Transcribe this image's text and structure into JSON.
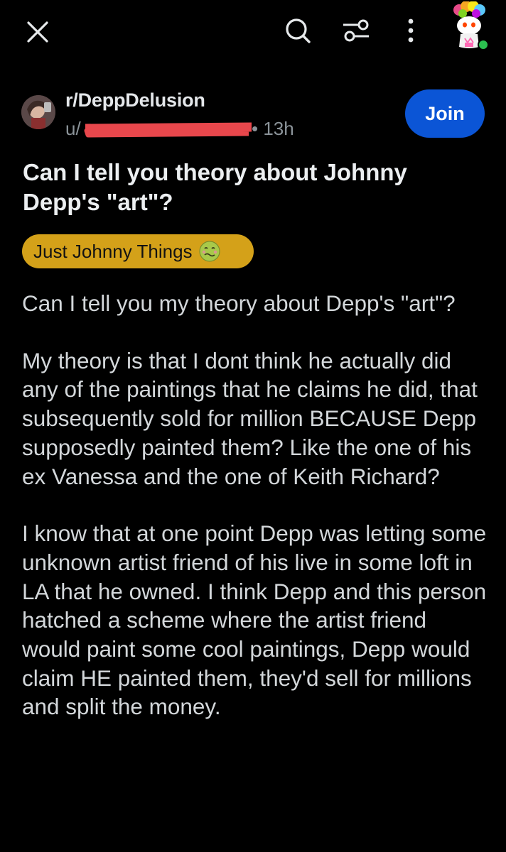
{
  "topbar": {
    "close_icon": "close-icon",
    "search_icon": "search-icon",
    "filter_icon": "sliders-icon",
    "more_icon": "more-vertical-icon",
    "online_status_color": "#2bbf4f"
  },
  "post": {
    "subreddit": "r/DeppDelusion",
    "user_prefix": "u/",
    "time": "• 13h",
    "join_label": "Join",
    "title": "Can I tell you theory about Johnny Depp's \"art\"?",
    "flair": {
      "label": "Just Johnny Things",
      "emoji": "nauseated-face",
      "color": "#d4a119"
    },
    "body": [
      "Can I tell you my theory about Depp's \"art\"?",
      "My theory is that I dont think he actually did any of the paintings that he claims he did, that subsequently sold for million BECAUSE Depp supposedly painted them? Like the one of his ex Vanessa and the one of Keith Richard?",
      "I know that at one point Depp was letting some unknown artist friend of his live in some loft in LA that he owned. I think Depp and this person hatched a scheme where the artist friend would paint some cool paintings, Depp would claim HE painted them, they'd sell for millions and split the money."
    ]
  },
  "colors": {
    "background": "#000000",
    "join_button": "#0b55d6",
    "redaction": "#e8474c"
  }
}
